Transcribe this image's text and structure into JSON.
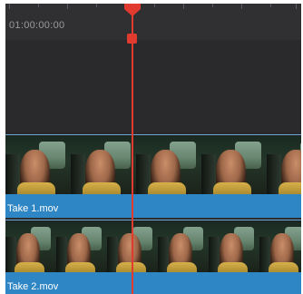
{
  "timeline": {
    "timecode": "01:00:00:00",
    "playhead_color": "#e03b2e",
    "tracks": [
      {
        "clip_name": "Take 1.mov",
        "clip_color": "#2f86c5"
      },
      {
        "clip_name": "Take 2.mov",
        "clip_color": "#2f86c5"
      }
    ]
  }
}
